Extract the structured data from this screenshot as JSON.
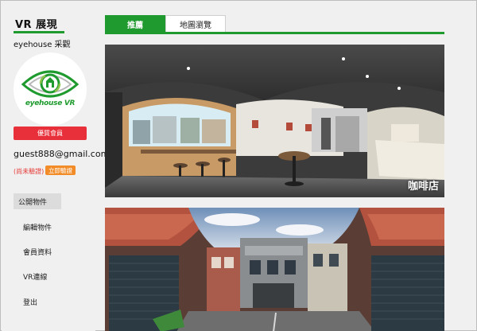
{
  "sidebar": {
    "brand": "VR 展現",
    "subtitle": "eyehouse 采觀",
    "logo_text": "eyehouse",
    "logo_vr": "VR",
    "upgrade_button": "優質會員",
    "email": "guest888@gmail.com",
    "unverified_text": "(尚未驗證)",
    "verify_button": "立即驗證",
    "menu": [
      {
        "label": "公開物件",
        "active": true
      },
      {
        "label": "編輯物件",
        "active": false
      },
      {
        "label": "會員資料",
        "active": false
      },
      {
        "label": "VR連線",
        "active": false
      },
      {
        "label": "登出",
        "active": false
      }
    ]
  },
  "main": {
    "tabs": [
      {
        "label": "推薦",
        "active": true
      },
      {
        "label": "地圖瀏覽",
        "active": false
      }
    ],
    "cards": [
      {
        "caption": "咖啡店"
      },
      {
        "caption": ""
      }
    ]
  },
  "colors": {
    "accent": "#1e9a2e",
    "danger": "#e8303a",
    "warning": "#f28c28",
    "unverified": "#e53935"
  }
}
